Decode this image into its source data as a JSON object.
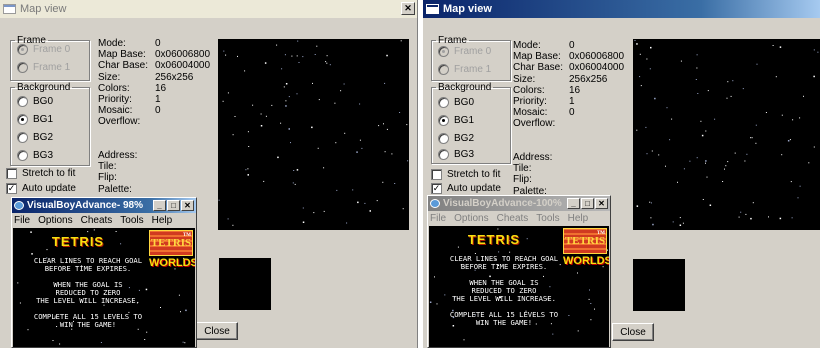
{
  "panels": [
    {
      "title": "Map view",
      "close_symbol": "✕",
      "active": false,
      "frame": {
        "legend": "Frame",
        "options": [
          "Frame 0",
          "Frame 1"
        ]
      },
      "background": {
        "legend": "Background",
        "options": [
          "BG0",
          "BG1",
          "BG2",
          "BG3"
        ],
        "selected": "BG1"
      },
      "stretch_label": "Stretch to fit",
      "auto_update_label": "Auto update",
      "info_labels": {
        "mode": "Mode:",
        "map_base": "Map Base:",
        "char_base": "Char Base:",
        "size": "Size:",
        "colors": "Colors:",
        "priority": "Priority:",
        "mosaic": "Mosaic:",
        "overflow": "Overflow:",
        "address": "Address:",
        "tile": "Tile:",
        "flip": "Flip:",
        "palette": "Palette:"
      },
      "info_values": {
        "mode": "0",
        "map_base": "0x06006800",
        "char_base": "0x06004000",
        "size": "256x256",
        "colors": "16",
        "priority": "1",
        "mosaic": "0"
      },
      "close_button": "Close",
      "vba": {
        "title": "VisualBoyAdvance- 98%",
        "menu": [
          "File",
          "Options",
          "Cheats",
          "Tools",
          "Help"
        ],
        "controls": [
          "_",
          "□",
          "✕"
        ],
        "game": {
          "title": "TETRIS",
          "logo_top": "TETRIS",
          "logo_bottom": "WORLDS",
          "logo_mark": "TM",
          "lines": [
            "CLEAR LINES TO REACH GOAL",
            "BEFORE TIME EXPIRES.",
            "",
            "WHEN THE GOAL IS",
            "REDUCED TO ZERO",
            "THE LEVEL WILL INCREASE.",
            "",
            "COMPLETE ALL 15 LEVELS TO",
            "WIN THE GAME!"
          ]
        }
      }
    },
    {
      "title": "Map view",
      "active": true,
      "frame": {
        "legend": "Frame",
        "options": [
          "Frame 0",
          "Frame 1"
        ]
      },
      "background": {
        "legend": "Background",
        "options": [
          "BG0",
          "BG1",
          "BG2",
          "BG3"
        ],
        "selected": "BG1"
      },
      "stretch_label": "Stretch to fit",
      "auto_update_label": "Auto update",
      "info_labels": {
        "mode": "Mode:",
        "map_base": "Map Base:",
        "char_base": "Char Base:",
        "size": "Size:",
        "colors": "Colors:",
        "priority": "Priority:",
        "mosaic": "Mosaic:",
        "overflow": "Overflow:",
        "address": "Address:",
        "tile": "Tile:",
        "flip": "Flip:",
        "palette": "Palette:"
      },
      "info_values": {
        "mode": "0",
        "map_base": "0x06006800",
        "char_base": "0x06004000",
        "size": "256x256",
        "colors": "16",
        "priority": "1",
        "mosaic": "0"
      },
      "close_button": "Close",
      "vba": {
        "title": "VisualBoyAdvance-100%",
        "menu": [
          "File",
          "Options",
          "Cheats",
          "Tools",
          "Help"
        ],
        "controls": [
          "_",
          "□",
          "✕"
        ],
        "game": {
          "title": "TETRIS",
          "logo_top": "TETRIS",
          "logo_bottom": "WORLDS",
          "logo_mark": "TM",
          "lines": [
            "CLEAR LINES TO REACH GOAL",
            "BEFORE TIME EXPIRES.",
            "",
            "WHEN THE GOAL IS",
            "REDUCED TO ZERO",
            "THE LEVEL WILL INCREASE.",
            "",
            "COMPLETE ALL 15 LEVELS TO",
            "WIN THE GAME!"
          ]
        }
      }
    }
  ],
  "colors": {
    "dialog_face": "#d4d0c8",
    "active_title": "#0a246a",
    "map_background": "#000000",
    "game_title": "#f8e010"
  }
}
